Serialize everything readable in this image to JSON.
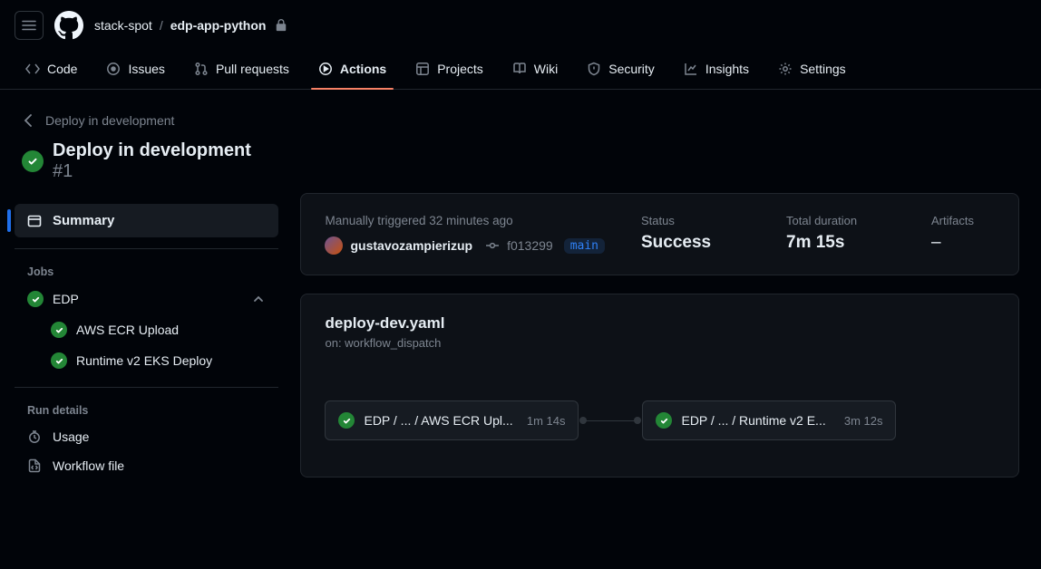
{
  "breadcrumb": {
    "owner": "stack-spot",
    "repo": "edp-app-python"
  },
  "nav": {
    "code": "Code",
    "issues": "Issues",
    "pulls": "Pull requests",
    "actions": "Actions",
    "projects": "Projects",
    "wiki": "Wiki",
    "security": "Security",
    "insights": "Insights",
    "settings": "Settings"
  },
  "run": {
    "back_label": "Deploy in development",
    "title": "Deploy in development",
    "number": "#1",
    "summary_label": "Summary"
  },
  "sidebar": {
    "jobs_heading": "Jobs",
    "job_group": "EDP",
    "job1": "AWS ECR Upload",
    "job2": "Runtime v2 EKS Deploy",
    "rundetails_heading": "Run details",
    "usage": "Usage",
    "workflow_file": "Workflow file"
  },
  "meta": {
    "trigger_line": "Manually triggered 32 minutes ago",
    "actor": "gustavozampierizup",
    "sha": "f013299",
    "branch": "main",
    "status_label": "Status",
    "status_value": "Success",
    "duration_label": "Total duration",
    "duration_value": "7m 15s",
    "artifacts_label": "Artifacts",
    "artifacts_value": "–"
  },
  "workflow": {
    "file": "deploy-dev.yaml",
    "on_line": "on: workflow_dispatch",
    "node1_label": "EDP / ... / AWS ECR Upl...",
    "node1_time": "1m 14s",
    "node2_label": "EDP / ... / Runtime v2 E...",
    "node2_time": "3m 12s"
  }
}
